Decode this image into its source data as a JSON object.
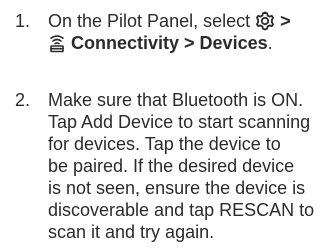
{
  "steps": [
    {
      "number": "1.",
      "text_prefix": "On the Pilot Panel, select",
      "settings_icon": "gear-icon",
      "separator": ">",
      "connectivity_icon": "wifi-signal-icon",
      "path": "Connectivity > Devices",
      "suffix": "."
    },
    {
      "number": "2.",
      "lines": [
        "Make sure that Bluetooth is ON.",
        "Tap Add Device to start scanning",
        "for devices. Tap the device to",
        "be paired. If the desired device",
        "is not seen, ensure the device is",
        "discoverable and tap RESCAN to",
        "scan it and try again."
      ]
    }
  ]
}
